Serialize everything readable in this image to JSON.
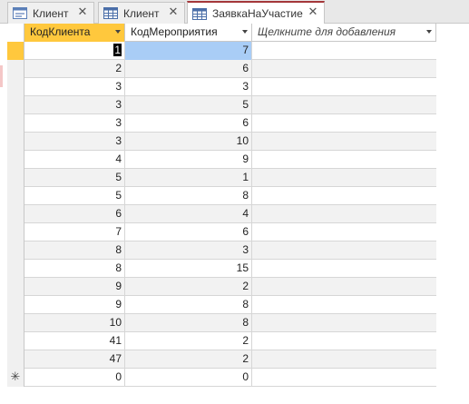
{
  "tabs": [
    {
      "label": "Клиент",
      "type": "form"
    },
    {
      "label": "Клиент",
      "type": "table"
    },
    {
      "label": "ЗаявкаНаУчастие",
      "type": "table",
      "active": true
    }
  ],
  "grid": {
    "columns": [
      "КодКлиента",
      "КодМероприятия",
      "Щелкните для добавления"
    ],
    "rows": [
      [
        "1",
        "7"
      ],
      [
        "2",
        "6"
      ],
      [
        "3",
        "3"
      ],
      [
        "3",
        "5"
      ],
      [
        "3",
        "6"
      ],
      [
        "3",
        "10"
      ],
      [
        "4",
        "9"
      ],
      [
        "5",
        "1"
      ],
      [
        "5",
        "8"
      ],
      [
        "6",
        "4"
      ],
      [
        "7",
        "6"
      ],
      [
        "8",
        "3"
      ],
      [
        "8",
        "15"
      ],
      [
        "9",
        "2"
      ],
      [
        "9",
        "8"
      ],
      [
        "10",
        "8"
      ],
      [
        "41",
        "2"
      ],
      [
        "47",
        "2"
      ]
    ],
    "new_row": {
      "marker": "✳",
      "values": [
        "0",
        "0"
      ]
    }
  },
  "colors": {
    "accent": "#a4373a",
    "selected_header": "#ffc83d",
    "highlight": "#a9cdf6"
  }
}
